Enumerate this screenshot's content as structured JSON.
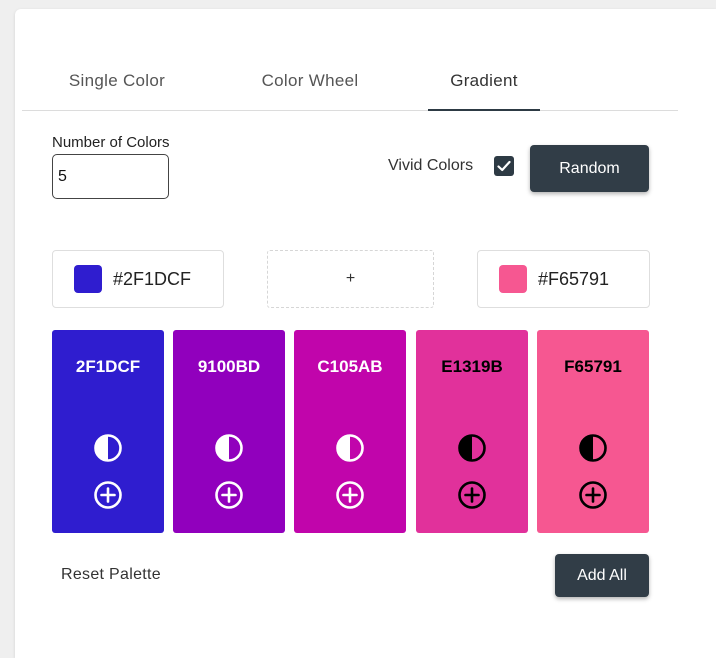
{
  "tabs": [
    {
      "label": "Single Color"
    },
    {
      "label": "Color Wheel"
    },
    {
      "label": "Gradient"
    }
  ],
  "controls": {
    "number_label": "Number of Colors",
    "number_value": "5",
    "vivid_label": "Vivid Colors",
    "vivid_checked": true,
    "random_label": "Random"
  },
  "gradient": {
    "start": {
      "hex": "#2F1DCF",
      "color": "#2F1DCF"
    },
    "middle_label": "+",
    "end": {
      "hex": "#F65791",
      "color": "#F65791"
    }
  },
  "swatches": [
    {
      "code": "2F1DCF",
      "color": "#2F1DCF",
      "text_color": "#ffffff",
      "contrast_icon": "contrast-icon",
      "add_icon": "plus-circle-icon"
    },
    {
      "code": "9100BD",
      "color": "#9100BD",
      "text_color": "#ffffff",
      "contrast_icon": "contrast-icon",
      "add_icon": "plus-circle-icon"
    },
    {
      "code": "C105AB",
      "color": "#C105AB",
      "text_color": "#ffffff",
      "contrast_icon": "contrast-icon",
      "add_icon": "plus-circle-icon"
    },
    {
      "code": "E1319B",
      "color": "#E1319B",
      "text_color": "#000000",
      "contrast_icon": "contrast-icon",
      "add_icon": "plus-circle-icon"
    },
    {
      "code": "F65791",
      "color": "#F65791",
      "text_color": "#000000",
      "contrast_icon": "contrast-icon",
      "add_icon": "plus-circle-icon"
    }
  ],
  "footer": {
    "reset_label": "Reset Palette",
    "add_all_label": "Add All"
  },
  "colors": {
    "button_dark": "#313D47",
    "tab_indicator": "#2D3A44"
  }
}
